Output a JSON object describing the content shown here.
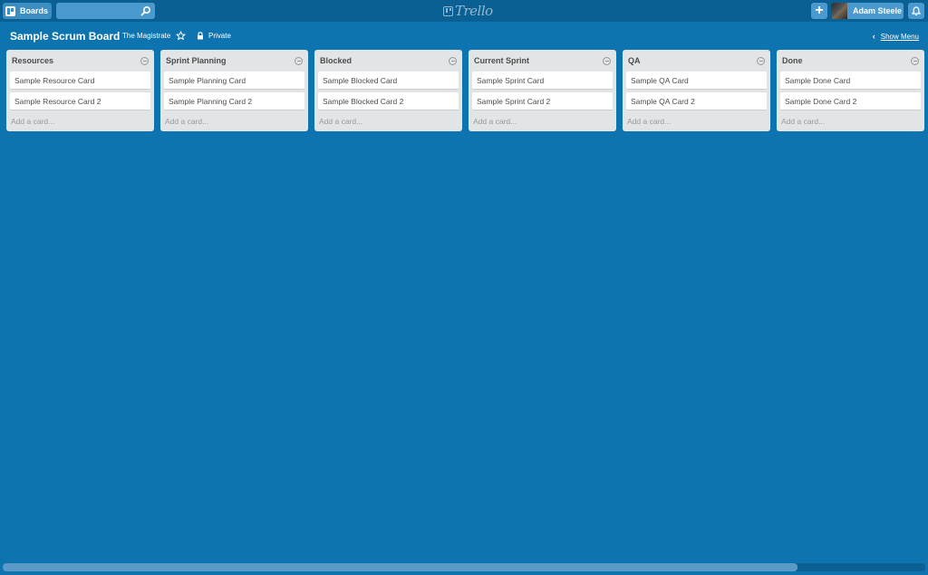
{
  "header": {
    "boards_label": "Boards",
    "search_value": "",
    "logo_text": "Trello",
    "add_label": "+",
    "user_name": "Adam Steele"
  },
  "board": {
    "title": "Sample Scrum Board",
    "team": "The Magistrate",
    "privacy": "Private",
    "show_menu": "Show Menu"
  },
  "lists": [
    {
      "title": "Resources",
      "cards": [
        "Sample Resource Card",
        "Sample Resource Card 2"
      ],
      "add_card": "Add a card..."
    },
    {
      "title": "Sprint Planning",
      "cards": [
        "Sample Planning Card",
        "Sample Planning Card 2"
      ],
      "add_card": "Add a card..."
    },
    {
      "title": "Blocked",
      "cards": [
        "Sample Blocked Card",
        "Sample Blocked Card 2"
      ],
      "add_card": "Add a card..."
    },
    {
      "title": "Current Sprint",
      "cards": [
        "Sample Sprint Card",
        "Sample Sprint Card 2"
      ],
      "add_card": "Add a card..."
    },
    {
      "title": "QA",
      "cards": [
        "Sample QA Card",
        "Sample QA Card 2"
      ],
      "add_card": "Add a card..."
    },
    {
      "title": "Done",
      "cards": [
        "Sample Done Card",
        "Sample Done Card 2"
      ],
      "add_card": "Add a card..."
    }
  ],
  "icons": {
    "boards": "board-icon",
    "search": "search-icon",
    "star": "star-icon",
    "lock": "lock-icon",
    "bell": "bell-icon",
    "list_menu": "list-menu-icon"
  },
  "colors": {
    "board_background": "#0e74b0",
    "header_background": "#0a5f93",
    "list_background": "#e2e4e6"
  }
}
